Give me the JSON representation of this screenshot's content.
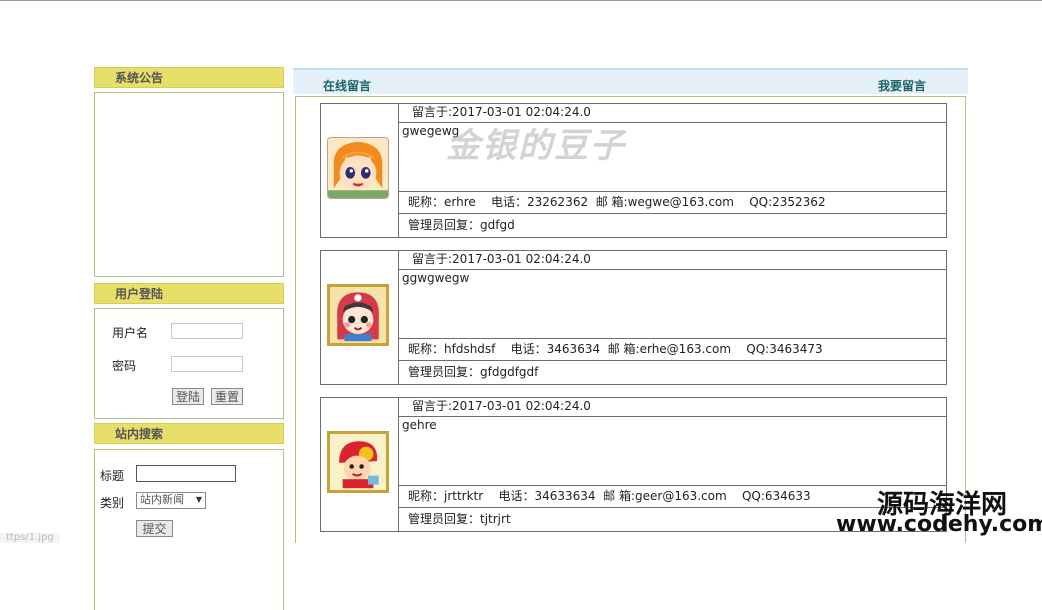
{
  "sidebar": {
    "notice": {
      "title": "系统公告"
    },
    "login": {
      "title": "用户登陆",
      "username_label": "用户名",
      "password_label": "密码",
      "login_button": "登陆",
      "reset_button": "重置"
    },
    "search": {
      "title": "站内搜索",
      "title_label": "标题",
      "category_label": "类别",
      "category_value": "站内新闻",
      "submit_button": "提交"
    }
  },
  "main": {
    "title": "在线留言",
    "write_link": "我要留言"
  },
  "messages": [
    {
      "time": "留言于:2017-03-01 02:04:24.0",
      "content": "gwegewg",
      "info": "昵称：erhre    电话：23262362  邮 箱:wegwe@163.com    QQ:2352362",
      "reply": "管理员回复：gdfgd"
    },
    {
      "time": "留言于:2017-03-01 02:04:24.0",
      "content": "ggwgwegw",
      "info": "昵称：hfdshdsf    电话：3463634  邮 箱:erhe@163.com    QQ:3463473",
      "reply": "管理员回复：gfdgdfgdf"
    },
    {
      "time": "留言于:2017-03-01 02:04:24.0",
      "content": "gehre",
      "info": "昵称：jrttrktr    电话：34633634  邮 箱:geer@163.com    QQ:634633",
      "reply": "管理员回复：tjtrjrt"
    }
  ],
  "overlay": {
    "watermark": "金银的豆子",
    "site_name": "源码海洋网",
    "site_url": "www.codehy.com",
    "status_url": "ttps/1.jpg"
  },
  "icons": {
    "avatar_1": "cartoon-girl-avatar-icon",
    "avatar_2": "cartoon-red-hood-avatar-icon",
    "avatar_3": "cartoon-kid-avatar-icon"
  }
}
